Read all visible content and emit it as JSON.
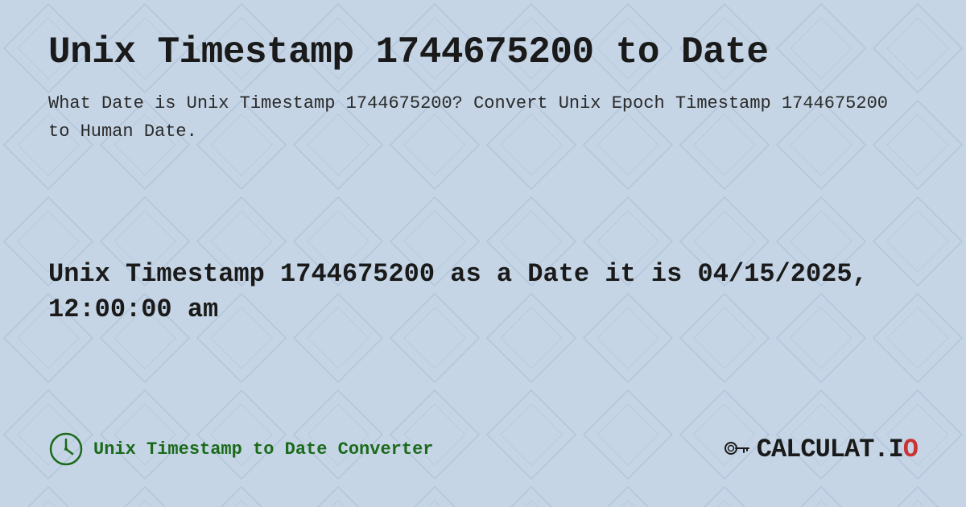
{
  "background": {
    "color": "#c5d5e5"
  },
  "header": {
    "title": "Unix Timestamp 1744675200 to Date"
  },
  "description": {
    "text": "What Date is Unix Timestamp 1744675200? Convert Unix Epoch Timestamp 1744675200 to Human Date."
  },
  "result": {
    "text": "Unix Timestamp 1744675200 as a Date it is 04/15/2025, 12:00:00 am"
  },
  "footer": {
    "link_text": "Unix Timestamp to Date Converter",
    "logo_text": "CALCULAT.IO"
  }
}
